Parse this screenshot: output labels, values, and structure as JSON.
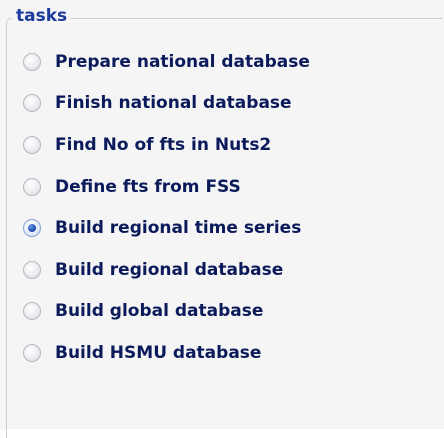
{
  "group": {
    "title": "tasks"
  },
  "radios": [
    {
      "label": "Prepare national database",
      "checked": false
    },
    {
      "label": "Finish national database",
      "checked": false
    },
    {
      "label": "Find No of fts in Nuts2",
      "checked": false
    },
    {
      "label": "Define fts from FSS",
      "checked": false
    },
    {
      "label": "Build regional time series",
      "checked": true
    },
    {
      "label": "Build regional database",
      "checked": false
    },
    {
      "label": "Build global database",
      "checked": false
    },
    {
      "label": "Build HSMU database",
      "checked": false
    }
  ],
  "colors": {
    "legend": "#1a3a9c",
    "label": "#0b1a5a",
    "selected_dot": "#2456b8"
  }
}
